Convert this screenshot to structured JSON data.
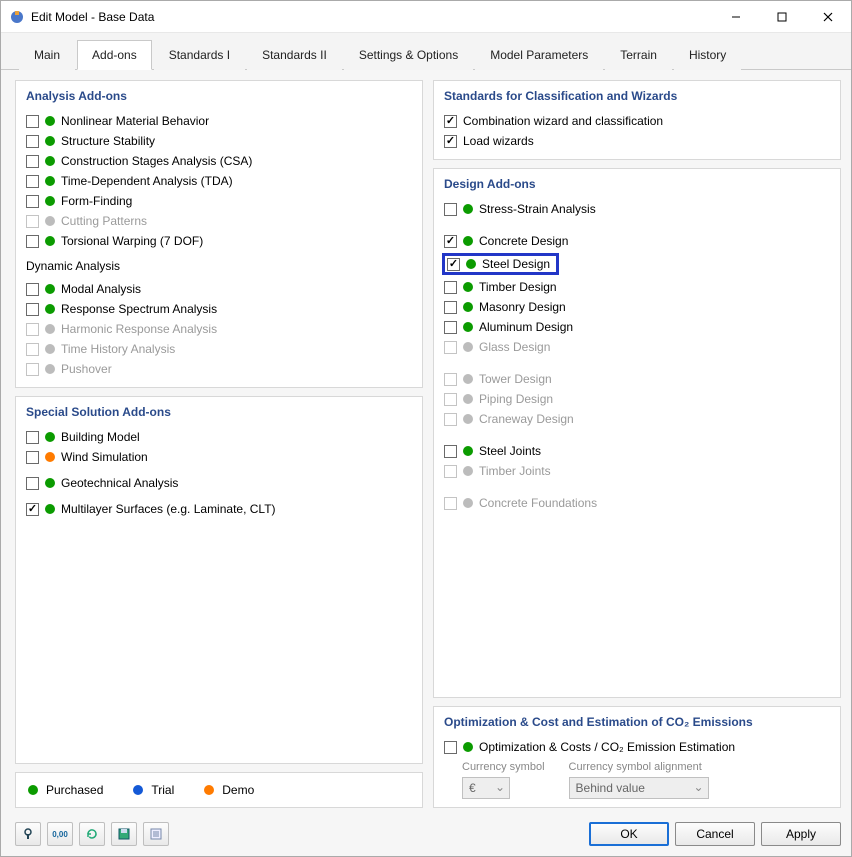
{
  "window": {
    "title": "Edit Model - Base Data"
  },
  "tabs": [
    "Main",
    "Add-ons",
    "Standards I",
    "Standards II",
    "Settings & Options",
    "Model Parameters",
    "Terrain",
    "History"
  ],
  "activeTab": 1,
  "left": {
    "analysis": {
      "title": "Analysis Add-ons",
      "items": [
        {
          "label": "Nonlinear Material Behavior",
          "checked": false,
          "dot": "green",
          "disabled": false
        },
        {
          "label": "Structure Stability",
          "checked": false,
          "dot": "green",
          "disabled": false
        },
        {
          "label": "Construction Stages Analysis (CSA)",
          "checked": false,
          "dot": "green",
          "disabled": false
        },
        {
          "label": "Time-Dependent Analysis (TDA)",
          "checked": false,
          "dot": "green",
          "disabled": false
        },
        {
          "label": "Form-Finding",
          "checked": false,
          "dot": "green",
          "disabled": false
        },
        {
          "label": "Cutting Patterns",
          "checked": false,
          "dot": "grey",
          "disabled": true
        },
        {
          "label": "Torsional Warping (7 DOF)",
          "checked": false,
          "dot": "green",
          "disabled": false
        }
      ],
      "dynTitle": "Dynamic Analysis",
      "dyn": [
        {
          "label": "Modal Analysis",
          "checked": false,
          "dot": "green",
          "disabled": false
        },
        {
          "label": "Response Spectrum Analysis",
          "checked": false,
          "dot": "green",
          "disabled": false
        },
        {
          "label": "Harmonic Response Analysis",
          "checked": false,
          "dot": "grey",
          "disabled": true
        },
        {
          "label": "Time History Analysis",
          "checked": false,
          "dot": "grey",
          "disabled": true
        },
        {
          "label": "Pushover",
          "checked": false,
          "dot": "grey",
          "disabled": true
        }
      ]
    },
    "special": {
      "title": "Special Solution Add-ons",
      "items": [
        {
          "label": "Building Model",
          "checked": false,
          "dot": "green",
          "disabled": false
        },
        {
          "label": "Wind Simulation",
          "checked": false,
          "dot": "orange",
          "disabled": false
        },
        {
          "label": "",
          "spacer": true
        },
        {
          "label": "Geotechnical Analysis",
          "checked": false,
          "dot": "green",
          "disabled": false
        },
        {
          "label": "",
          "spacer": true
        },
        {
          "label": "Multilayer Surfaces (e.g. Laminate, CLT)",
          "checked": true,
          "dot": "green",
          "disabled": false
        }
      ]
    }
  },
  "right": {
    "standards": {
      "title": "Standards for Classification and Wizards",
      "items": [
        {
          "label": "Combination wizard and classification",
          "checked": true
        },
        {
          "label": "Load wizards",
          "checked": true
        }
      ]
    },
    "design": {
      "title": "Design Add-ons",
      "groups": [
        [
          {
            "label": "Stress-Strain Analysis",
            "checked": false,
            "dot": "green",
            "disabled": false
          }
        ],
        [
          {
            "label": "Concrete Design",
            "checked": true,
            "dot": "green",
            "disabled": false
          },
          {
            "label": "Steel Design",
            "checked": true,
            "dot": "green",
            "disabled": false,
            "highlight": true
          },
          {
            "label": "Timber Design",
            "checked": false,
            "dot": "green",
            "disabled": false
          },
          {
            "label": "Masonry Design",
            "checked": false,
            "dot": "green",
            "disabled": false
          },
          {
            "label": "Aluminum Design",
            "checked": false,
            "dot": "green",
            "disabled": false
          },
          {
            "label": "Glass Design",
            "checked": false,
            "dot": "grey",
            "disabled": true
          }
        ],
        [
          {
            "label": "Tower Design",
            "checked": false,
            "dot": "grey",
            "disabled": true
          },
          {
            "label": "Piping Design",
            "checked": false,
            "dot": "grey",
            "disabled": true
          },
          {
            "label": "Craneway Design",
            "checked": false,
            "dot": "grey",
            "disabled": true
          }
        ],
        [
          {
            "label": "Steel Joints",
            "checked": false,
            "dot": "green",
            "disabled": false
          },
          {
            "label": "Timber Joints",
            "checked": false,
            "dot": "grey",
            "disabled": true
          }
        ],
        [
          {
            "label": "Concrete Foundations",
            "checked": false,
            "dot": "grey",
            "disabled": true
          }
        ]
      ]
    },
    "opt": {
      "title": "Optimization & Cost and Estimation of CO₂ Emissions",
      "item": {
        "label": "Optimization & Costs / CO₂ Emission Estimation",
        "checked": false,
        "dot": "green"
      },
      "currencyLabel": "Currency symbol",
      "currencyValue": "€",
      "alignLabel": "Currency symbol alignment",
      "alignValue": "Behind value"
    }
  },
  "legend": {
    "purchased": "Purchased",
    "trial": "Trial",
    "demo": "Demo"
  },
  "footer": {
    "ok": "OK",
    "cancel": "Cancel",
    "apply": "Apply"
  }
}
